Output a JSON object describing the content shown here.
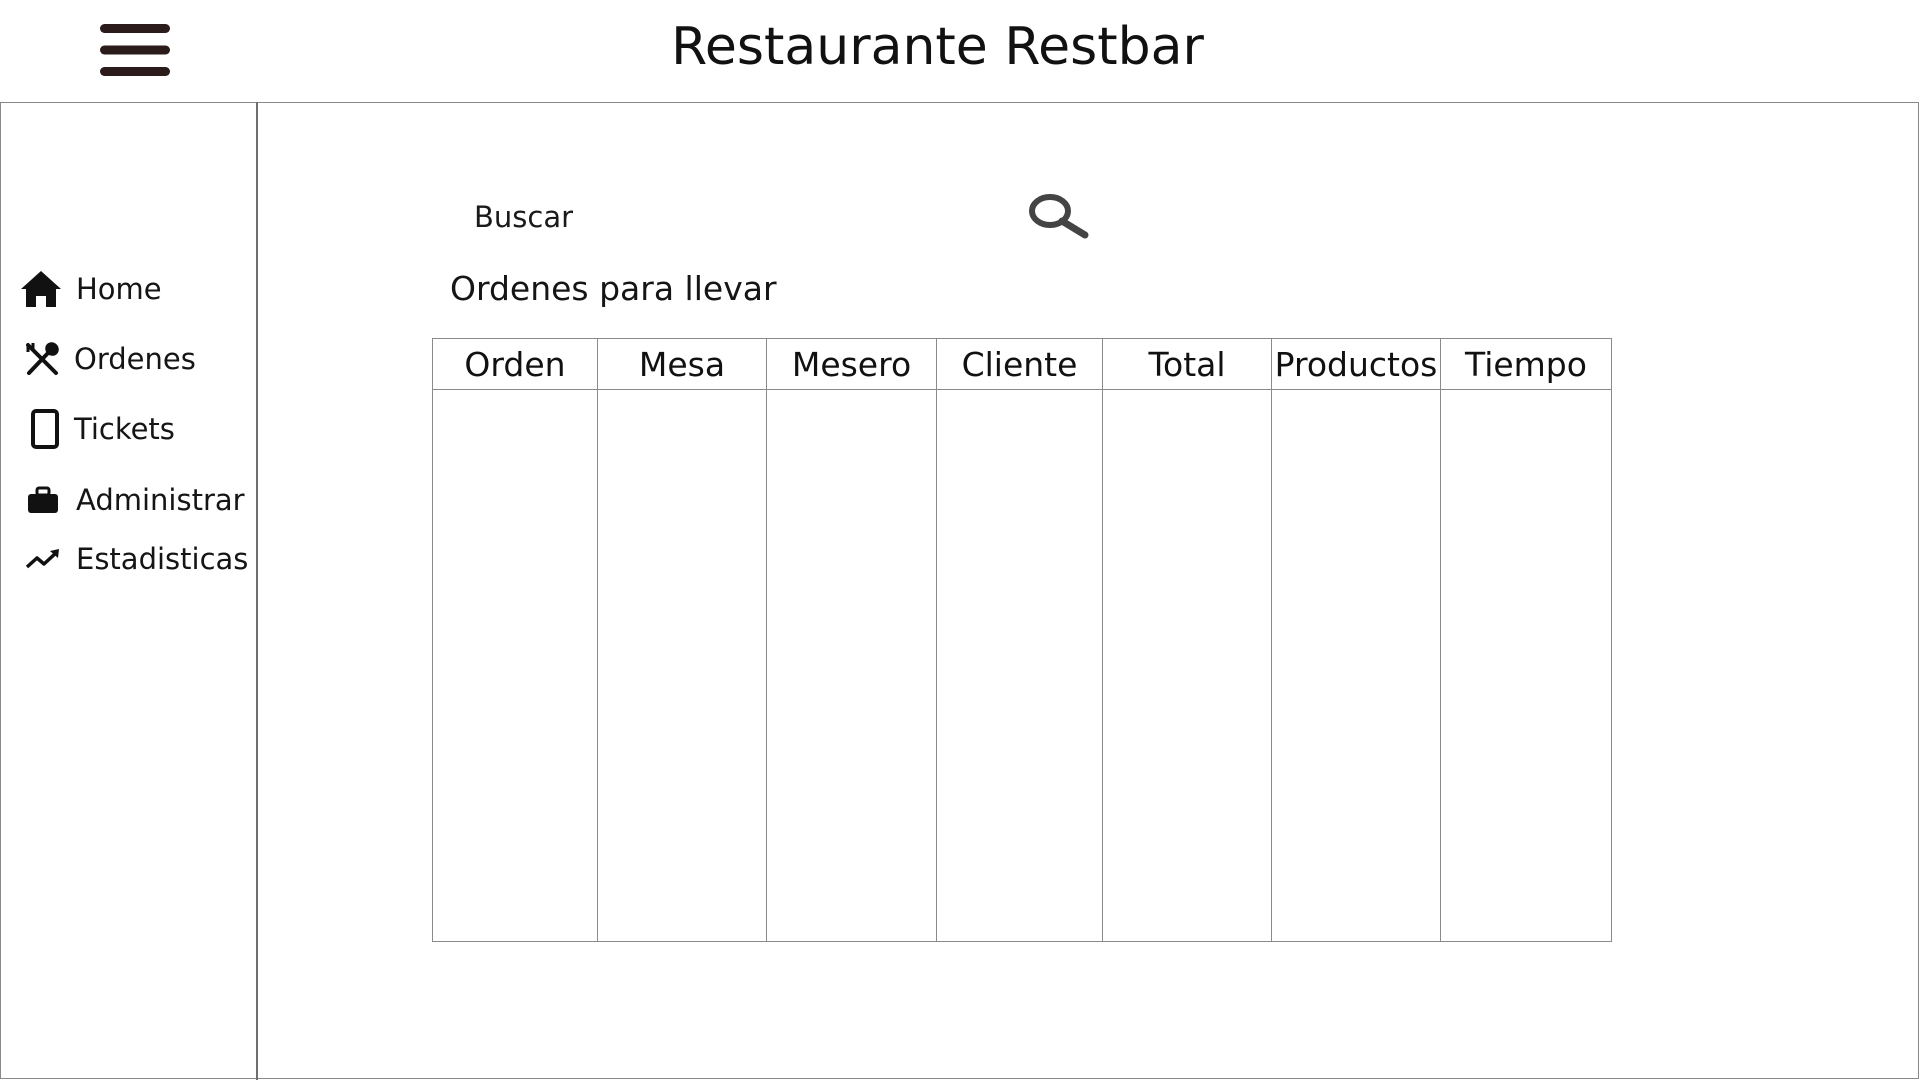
{
  "header": {
    "title": "Restaurante Restbar",
    "menu_icon": "hamburger-icon"
  },
  "sidebar": {
    "items": [
      {
        "label": "Home",
        "icon": "home-icon"
      },
      {
        "label": "Ordenes",
        "icon": "fork-knife-icon"
      },
      {
        "label": "Tickets",
        "icon": "tablet-icon"
      },
      {
        "label": "Administrar",
        "icon": "briefcase-icon"
      },
      {
        "label": "Estadisticas",
        "icon": "trending-up-icon"
      }
    ]
  },
  "search": {
    "label": "Buscar",
    "icon": "search-icon"
  },
  "main": {
    "section_title": "Ordenes para llevar",
    "table": {
      "columns": [
        "Orden",
        "Mesa",
        "Mesero",
        "Cliente",
        "Total",
        "Productos",
        "Tiempo"
      ],
      "rows": []
    }
  },
  "colors": {
    "text": "#111111",
    "border": "#8a8a8a",
    "menu_icon": "#2b1b1b"
  }
}
